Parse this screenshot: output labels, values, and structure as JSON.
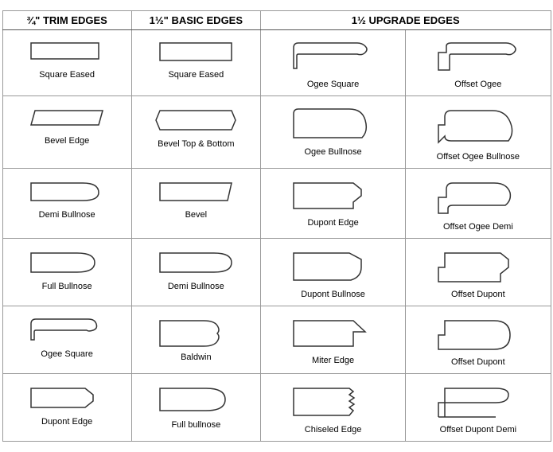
{
  "headers": {
    "col1": "¾\" TRIM EDGES",
    "col2": "1½\" BASIC EDGES",
    "col3_main": "1½ UPGRADE EDGES"
  },
  "rows": [
    {
      "trim": "Square Eased",
      "basic": "Square Eased",
      "upgrade1": "Ogee Square",
      "upgrade2": "Offset Ogee"
    },
    {
      "trim": "Bevel Edge",
      "basic": "Bevel Top & Bottom",
      "upgrade1": "Ogee Bullnose",
      "upgrade2": "Offset Ogee Bullnose"
    },
    {
      "trim": "Demi Bullnose",
      "basic": "Bevel",
      "upgrade1": "Dupont Edge",
      "upgrade2": "Offset Ogee Demi"
    },
    {
      "trim": "Full Bullnose",
      "basic": "Demi Bullnose",
      "upgrade1": "Dupont Bullnose",
      "upgrade2": "Offset Dupont"
    },
    {
      "trim": "Ogee Square",
      "basic": "Baldwin",
      "upgrade1": "Miter Edge",
      "upgrade2": "Offset Dupont"
    },
    {
      "trim": "Dupont Edge",
      "basic": "Full bullnose",
      "upgrade1": "Chiseled Edge",
      "upgrade2": "Offset Dupont Demi"
    }
  ]
}
